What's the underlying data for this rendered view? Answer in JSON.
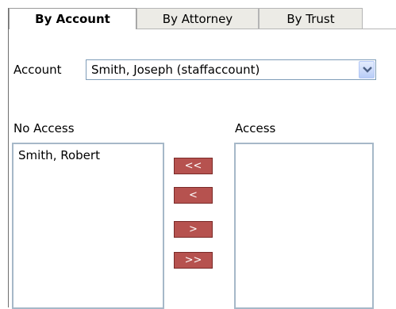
{
  "tabs": [
    {
      "label": "By Account",
      "active": true
    },
    {
      "label": "By Attorney",
      "active": false
    },
    {
      "label": "By Trust",
      "active": false
    }
  ],
  "account": {
    "label": "Account",
    "selected": "Smith, Joseph (staffaccount)"
  },
  "no_access": {
    "label": "No Access",
    "items": [
      "Smith, Robert"
    ]
  },
  "access": {
    "label": "Access",
    "items": []
  },
  "move_buttons": {
    "move_all_left": "<<",
    "move_left": "<",
    "move_right": ">",
    "move_all_right": ">>"
  },
  "colors": {
    "button_bg": "#b6524f",
    "tab_bg": "#ecebe6",
    "listbox_border": "#a6b8c8"
  }
}
